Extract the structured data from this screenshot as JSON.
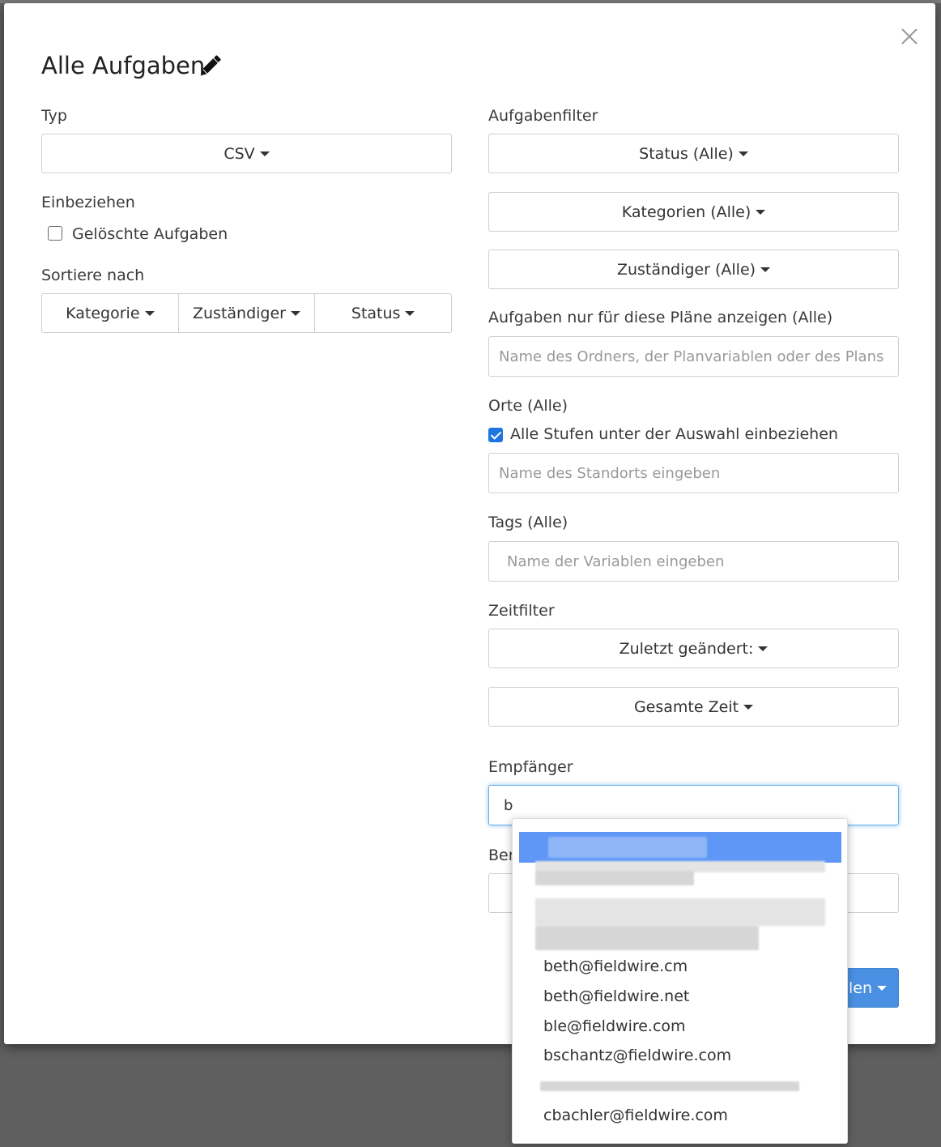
{
  "modal": {
    "title": "Alle Aufgaben"
  },
  "left": {
    "typ_label": "Typ",
    "typ_value": "CSV",
    "einbeziehen_label": "Einbeziehen",
    "deleted_tasks_label": "Gelöschte Aufgaben",
    "deleted_tasks_checked": false,
    "sort_label": "Sortiere nach",
    "sort_buttons": [
      "Kategorie",
      "Zuständiger",
      "Status"
    ]
  },
  "right": {
    "filter_label": "Aufgabenfilter",
    "status_btn": "Status (Alle)",
    "categories_btn": "Kategorien (Alle)",
    "assignee_btn": "Zuständiger (Alle)",
    "plans_label": "Aufgaben nur für diese Pläne anzeigen (Alle)",
    "plans_placeholder": "Name des Ordners, der Planvariablen oder des Plans eingeben",
    "locations_label": "Orte (Alle)",
    "include_levels_label": "Alle Stufen unter der Auswahl einbeziehen",
    "include_levels_checked": true,
    "location_placeholder": "Name des Standorts eingeben",
    "tags_label": "Tags (Alle)",
    "tags_placeholder": "Name der Variablen eingeben",
    "time_label": "Zeitfilter",
    "last_changed_btn": "Zuletzt geändert:",
    "total_time_btn": "Gesamte Zeit",
    "recipients_label": "Empfänger",
    "recipients_value": "b",
    "partial_label": "Ber",
    "submit_partial": "llen"
  },
  "dropdown": {
    "items": [
      "beth@fieldwire.cm",
      "beth@fieldwire.net",
      "ble@fieldwire.com",
      "bschantz@fieldwire.com",
      "cbachler@fieldwire.com"
    ]
  },
  "colors": {
    "primary": "#4a90e2",
    "highlight": "#5e97f6",
    "checkbox": "#1f75e0"
  }
}
